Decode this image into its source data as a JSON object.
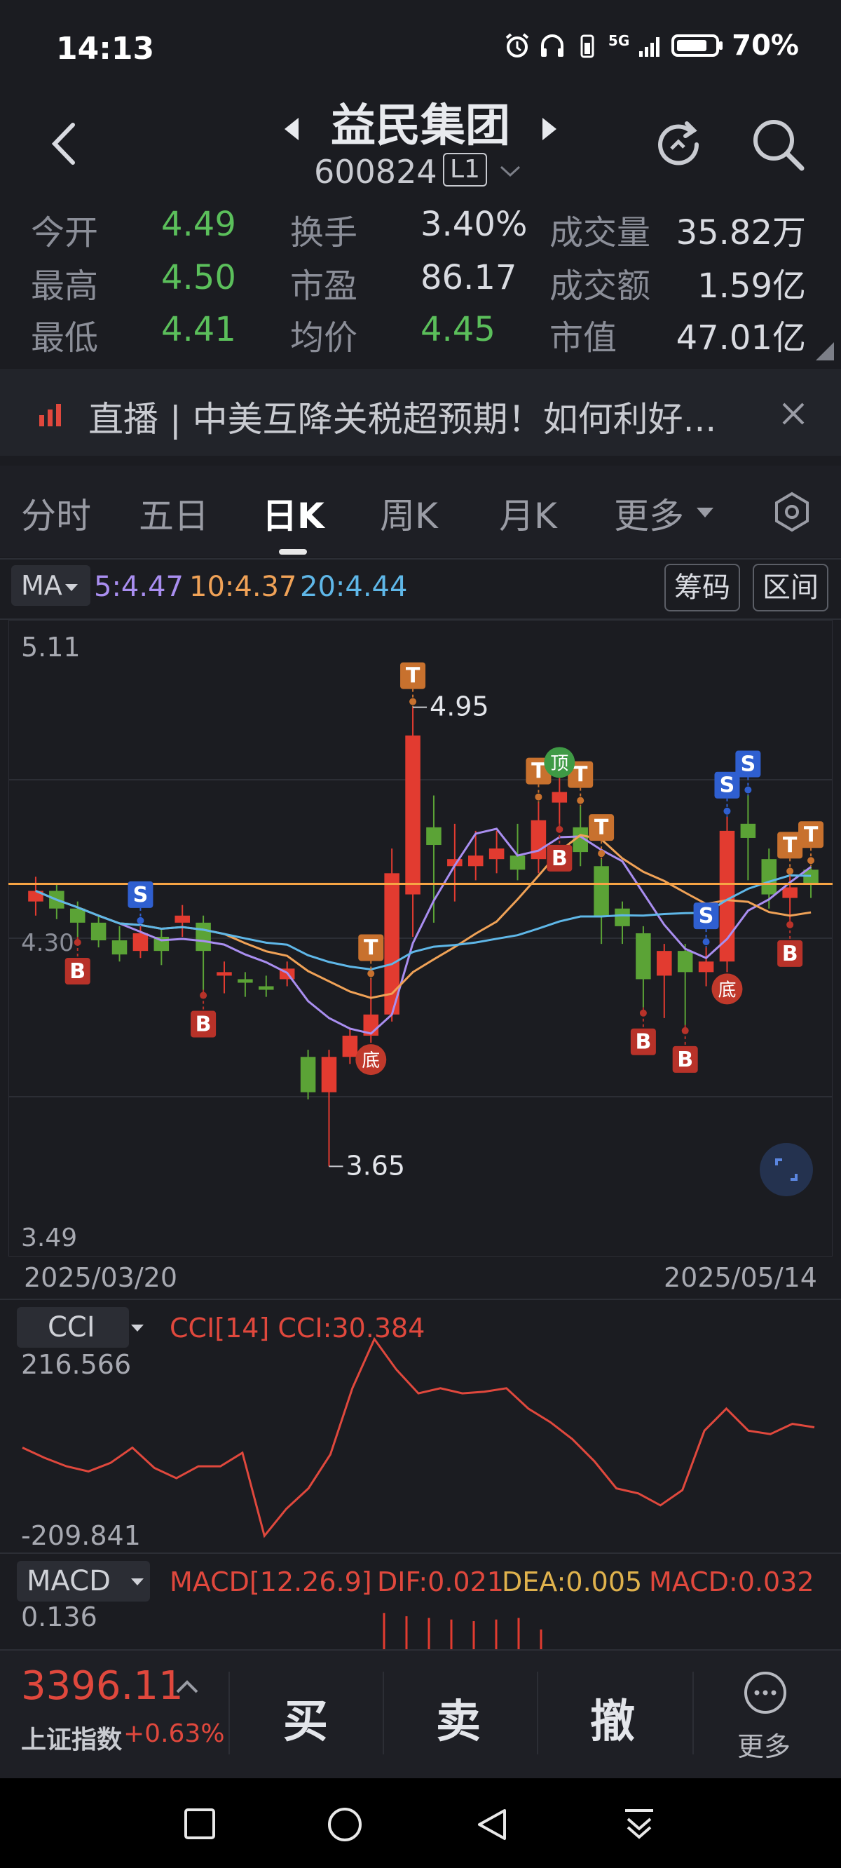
{
  "status_bar": {
    "time": "14:13",
    "battery": "70%",
    "network": "5G"
  },
  "header": {
    "stock_name": "益民集团",
    "stock_code": "600824",
    "level_badge": "L1"
  },
  "quote": {
    "rows": [
      [
        {
          "label": "今开",
          "value": "4.49",
          "color": "green"
        },
        {
          "label": "换手",
          "value": "3.40%",
          "color": "normal"
        },
        {
          "label": "成交量",
          "value": "35.82万",
          "color": "normal"
        }
      ],
      [
        {
          "label": "最高",
          "value": "4.50",
          "color": "green"
        },
        {
          "label": "市盈",
          "value": "86.17",
          "color": "normal"
        },
        {
          "label": "成交额",
          "value": "1.59亿",
          "color": "normal"
        }
      ],
      [
        {
          "label": "最低",
          "value": "4.41",
          "color": "green"
        },
        {
          "label": "均价",
          "value": "4.45",
          "color": "green"
        },
        {
          "label": "市值",
          "value": "47.01亿",
          "color": "normal"
        }
      ]
    ]
  },
  "news": {
    "text": "直播 | 中美互降关税超预期！如何利好..."
  },
  "tabs": [
    "分时",
    "五日",
    "日K",
    "周K",
    "月K",
    "更多"
  ],
  "active_tab": "日K",
  "ma_bar": {
    "selector": "MA",
    "ma5": "5:4.47",
    "ma10": "10:4.37",
    "ma20": "20:4.44",
    "chip_button": "筹码",
    "range_button": "区间"
  },
  "kline": {
    "y_top_label": "5.11",
    "y_bottom_label": "3.49",
    "y_mid_label": "4.30",
    "high_label": "4.95",
    "low_label": "3.65",
    "start_date": "2025/03/20",
    "end_date": "2025/05/14",
    "markers": {
      "bottom_text": "底",
      "top_text": "顶",
      "S": "S",
      "B": "B",
      "T": "T"
    }
  },
  "cci": {
    "selector": "CCI",
    "title": "CCI[14] CCI:30.384",
    "top_label": "216.566",
    "bottom_label": "-209.841"
  },
  "macd": {
    "selector": "MACD",
    "param": "MACD[12.26.9]",
    "dif": "DIF:0.021",
    "dea": "DEA:0.005",
    "macd": "MACD:0.032",
    "top_label": "0.136"
  },
  "bottom_bar": {
    "index_value": "3396.11",
    "index_name": "上证指数",
    "index_change": "+0.63%",
    "buy": "买",
    "sell": "卖",
    "cancel": "撤",
    "more": "更多"
  },
  "colors": {
    "up": "#e23b30",
    "down": "#5ba336",
    "ma5": "#a98ef0",
    "ma10": "#f0a257",
    "ma20": "#5fb7e8",
    "price_line": "#f7a444",
    "cci": "#e0483d"
  },
  "chart_data": {
    "type": "candlestick",
    "dates_range": [
      "2025/03/20",
      "2025/05/14"
    ],
    "ylim": [
      3.49,
      5.11
    ],
    "candles": [
      {
        "o": 4.4,
        "c": 4.43,
        "h": 4.47,
        "l": 4.36
      },
      {
        "o": 4.43,
        "c": 4.38,
        "h": 4.45,
        "l": 4.35
      },
      {
        "o": 4.38,
        "c": 4.34,
        "h": 4.4,
        "l": 4.3
      },
      {
        "o": 4.34,
        "c": 4.29,
        "h": 4.36,
        "l": 4.27
      },
      {
        "o": 4.29,
        "c": 4.25,
        "h": 4.33,
        "l": 4.23
      },
      {
        "o": 4.26,
        "c": 4.31,
        "h": 4.33,
        "l": 4.24
      },
      {
        "o": 4.3,
        "c": 4.26,
        "h": 4.32,
        "l": 4.22
      },
      {
        "o": 4.34,
        "c": 4.36,
        "h": 4.39,
        "l": 4.3
      },
      {
        "o": 4.34,
        "c": 4.26,
        "h": 4.36,
        "l": 4.15
      },
      {
        "o": 4.19,
        "c": 4.2,
        "h": 4.23,
        "l": 4.14
      },
      {
        "o": 4.18,
        "c": 4.17,
        "h": 4.2,
        "l": 4.13
      },
      {
        "o": 4.16,
        "c": 4.15,
        "h": 4.19,
        "l": 4.13
      },
      {
        "o": 4.18,
        "c": 4.21,
        "h": 4.23,
        "l": 4.16
      },
      {
        "o": 3.96,
        "c": 3.86,
        "h": 3.98,
        "l": 3.84
      },
      {
        "o": 3.86,
        "c": 3.96,
        "h": 3.98,
        "l": 3.65
      },
      {
        "o": 3.96,
        "c": 4.02,
        "h": 4.04,
        "l": 3.94
      },
      {
        "o": 4.02,
        "c": 4.08,
        "h": 4.18,
        "l": 4.0
      },
      {
        "o": 4.08,
        "c": 4.48,
        "h": 4.55,
        "l": 4.06
      },
      {
        "o": 4.42,
        "c": 4.87,
        "h": 4.95,
        "l": 4.3
      },
      {
        "o": 4.61,
        "c": 4.56,
        "h": 4.7,
        "l": 4.34
      },
      {
        "o": 4.5,
        "c": 4.52,
        "h": 4.62,
        "l": 4.4
      },
      {
        "o": 4.5,
        "c": 4.53,
        "h": 4.6,
        "l": 4.46
      },
      {
        "o": 4.52,
        "c": 4.55,
        "h": 4.6,
        "l": 4.48
      },
      {
        "o": 4.53,
        "c": 4.49,
        "h": 4.62,
        "l": 4.46
      },
      {
        "o": 4.52,
        "c": 4.63,
        "h": 4.68,
        "l": 4.48
      },
      {
        "o": 4.68,
        "c": 4.71,
        "h": 4.75,
        "l": 4.62
      },
      {
        "o": 4.61,
        "c": 4.54,
        "h": 4.67,
        "l": 4.5
      },
      {
        "o": 4.5,
        "c": 4.36,
        "h": 4.52,
        "l": 4.28
      },
      {
        "o": 4.38,
        "c": 4.33,
        "h": 4.4,
        "l": 4.28
      },
      {
        "o": 4.31,
        "c": 4.18,
        "h": 4.33,
        "l": 4.1
      },
      {
        "o": 4.19,
        "c": 4.26,
        "h": 4.28,
        "l": 4.07
      },
      {
        "o": 4.26,
        "c": 4.2,
        "h": 4.28,
        "l": 4.05
      },
      {
        "o": 4.2,
        "c": 4.23,
        "h": 4.27,
        "l": 4.16
      },
      {
        "o": 4.23,
        "c": 4.6,
        "h": 4.64,
        "l": 4.2
      },
      {
        "o": 4.62,
        "c": 4.58,
        "h": 4.7,
        "l": 4.46
      },
      {
        "o": 4.52,
        "c": 4.42,
        "h": 4.55,
        "l": 4.38
      },
      {
        "o": 4.41,
        "c": 4.44,
        "h": 4.47,
        "l": 4.35
      },
      {
        "o": 4.49,
        "c": 4.45,
        "h": 4.5,
        "l": 4.41
      }
    ],
    "cci_values": [
      60,
      30,
      5,
      -10,
      15,
      60,
      0,
      -30,
      5,
      5,
      45,
      -200,
      -120,
      -60,
      40,
      235,
      380,
      290,
      220,
      235,
      220,
      225,
      235,
      175,
      135,
      85,
      20,
      -60,
      -75,
      -110,
      -65,
      110,
      175,
      110,
      100,
      130,
      120
    ],
    "macd_bars": [
      0.11,
      0.1,
      0.095,
      0.09,
      0.085,
      0.09,
      0.095,
      0.06
    ]
  }
}
